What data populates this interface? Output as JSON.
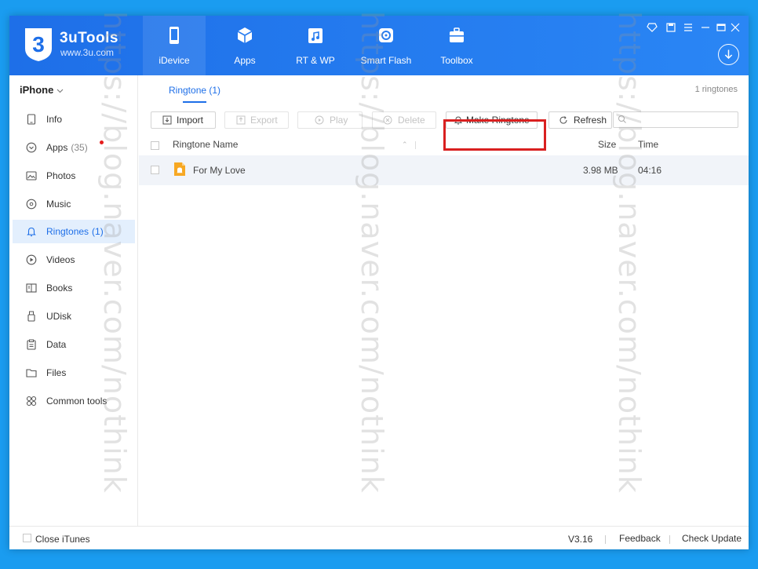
{
  "app": {
    "name": "3uTools",
    "url": "www.3u.com",
    "logo_digit": "3"
  },
  "nav": [
    {
      "label": "iDevice",
      "icon": "phone-icon",
      "active": true
    },
    {
      "label": "Apps",
      "icon": "apps-cube-icon",
      "active": false
    },
    {
      "label": "RT & WP",
      "icon": "music-folder-icon",
      "active": false
    },
    {
      "label": "Smart Flash",
      "icon": "flash-gear-icon",
      "active": false
    },
    {
      "label": "Toolbox",
      "icon": "toolbox-icon",
      "active": false
    }
  ],
  "sidebar": {
    "device": "iPhone",
    "items": [
      {
        "label": "Info",
        "count": "",
        "icon": "info-device-icon",
        "active": false
      },
      {
        "label": "Apps",
        "count": "(35)",
        "icon": "apps-icon",
        "active": false,
        "badge": true
      },
      {
        "label": "Photos",
        "count": "",
        "icon": "photos-icon",
        "active": false
      },
      {
        "label": "Music",
        "count": "",
        "icon": "music-icon",
        "active": false
      },
      {
        "label": "Ringtones",
        "count": "(1)",
        "icon": "bell-icon",
        "active": true
      },
      {
        "label": "Videos",
        "count": "",
        "icon": "video-play-icon",
        "active": false
      },
      {
        "label": "Books",
        "count": "",
        "icon": "book-icon",
        "active": false
      },
      {
        "label": "UDisk",
        "count": "",
        "icon": "udisk-icon",
        "active": false
      },
      {
        "label": "Data",
        "count": "",
        "icon": "data-icon",
        "active": false
      },
      {
        "label": "Files",
        "count": "",
        "icon": "folder-icon",
        "active": false
      },
      {
        "label": "Common tools",
        "count": "",
        "icon": "tools-grid-icon",
        "active": false
      }
    ]
  },
  "main": {
    "tab_label": "Ringtone (1)",
    "count_label": "1 ringtones",
    "toolbar": {
      "import": "Import",
      "export": "Export",
      "play": "Play",
      "delete": "Delete",
      "make_ringtone": "Make Ringtone",
      "refresh": "Refresh"
    },
    "search": {
      "value": "",
      "placeholder": ""
    },
    "columns": {
      "name": "Ringtone Name",
      "size": "Size",
      "time": "Time"
    },
    "rows": [
      {
        "name": "For My Love",
        "size": "3.98 MB",
        "time": "04:16"
      }
    ]
  },
  "status": {
    "close_itunes": "Close iTunes",
    "version": "V3.16",
    "feedback": "Feedback",
    "check_update": "Check Update"
  },
  "watermark": "https://blog.naver.com/nothink",
  "colors": {
    "brand_blue": "#1e6fe8",
    "highlight_red": "#d92020",
    "badge_red": "#e51d1d",
    "desktop_blue": "#1a9cf0"
  }
}
